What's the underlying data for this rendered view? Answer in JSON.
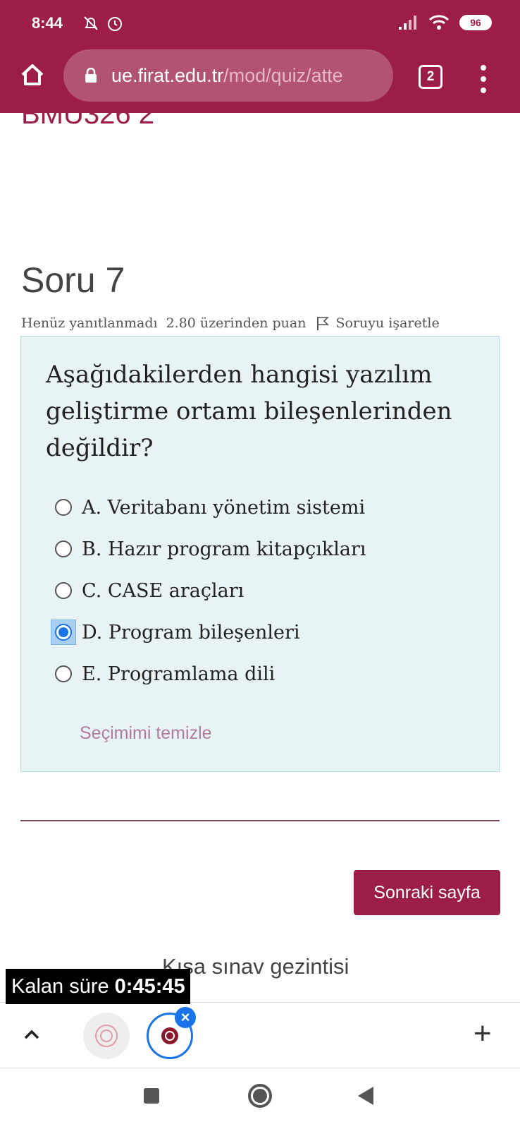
{
  "status_bar": {
    "time": "8:44",
    "battery": "96",
    "icons": [
      "bell-off-icon",
      "alarm-icon",
      "signal-icon",
      "wifi-icon",
      "battery-icon"
    ]
  },
  "browser": {
    "url_host": "ue.firat.edu.tr",
    "url_path": "/mod/quiz/atte",
    "tab_count": "2"
  },
  "page": {
    "course_title": "BMU326 2",
    "question_title": "Soru 7",
    "meta": {
      "status": "Henüz yanıtlanmadı",
      "points": "2.80 üzerinden puan",
      "flag_label": "Soruyu işaretle"
    },
    "question_text": "Aşağıdakilerden hangisi yazılım geliştirme ortamı bileşenlerinden değildir?",
    "answers": [
      {
        "label": "A. Veritabanı yönetim sistemi",
        "selected": false
      },
      {
        "label": "B. Hazır program kitapçıkları",
        "selected": false
      },
      {
        "label": "C. CASE araçları",
        "selected": false
      },
      {
        "label": "D. Program bileşenleri",
        "selected": true
      },
      {
        "label": "E. Programlama dili",
        "selected": false
      }
    ],
    "clear_choice": "Seçimimi temizle",
    "next_button": "Sonraki sayfa",
    "navigation_title": "Kısa sınav gezintisi",
    "timer_label": "Kalan süre",
    "timer_value": "0:45:45"
  },
  "colors": {
    "brand": "#9c1d47",
    "question_bg": "#e7f3f5",
    "radio_selected": "#1a73e8"
  }
}
